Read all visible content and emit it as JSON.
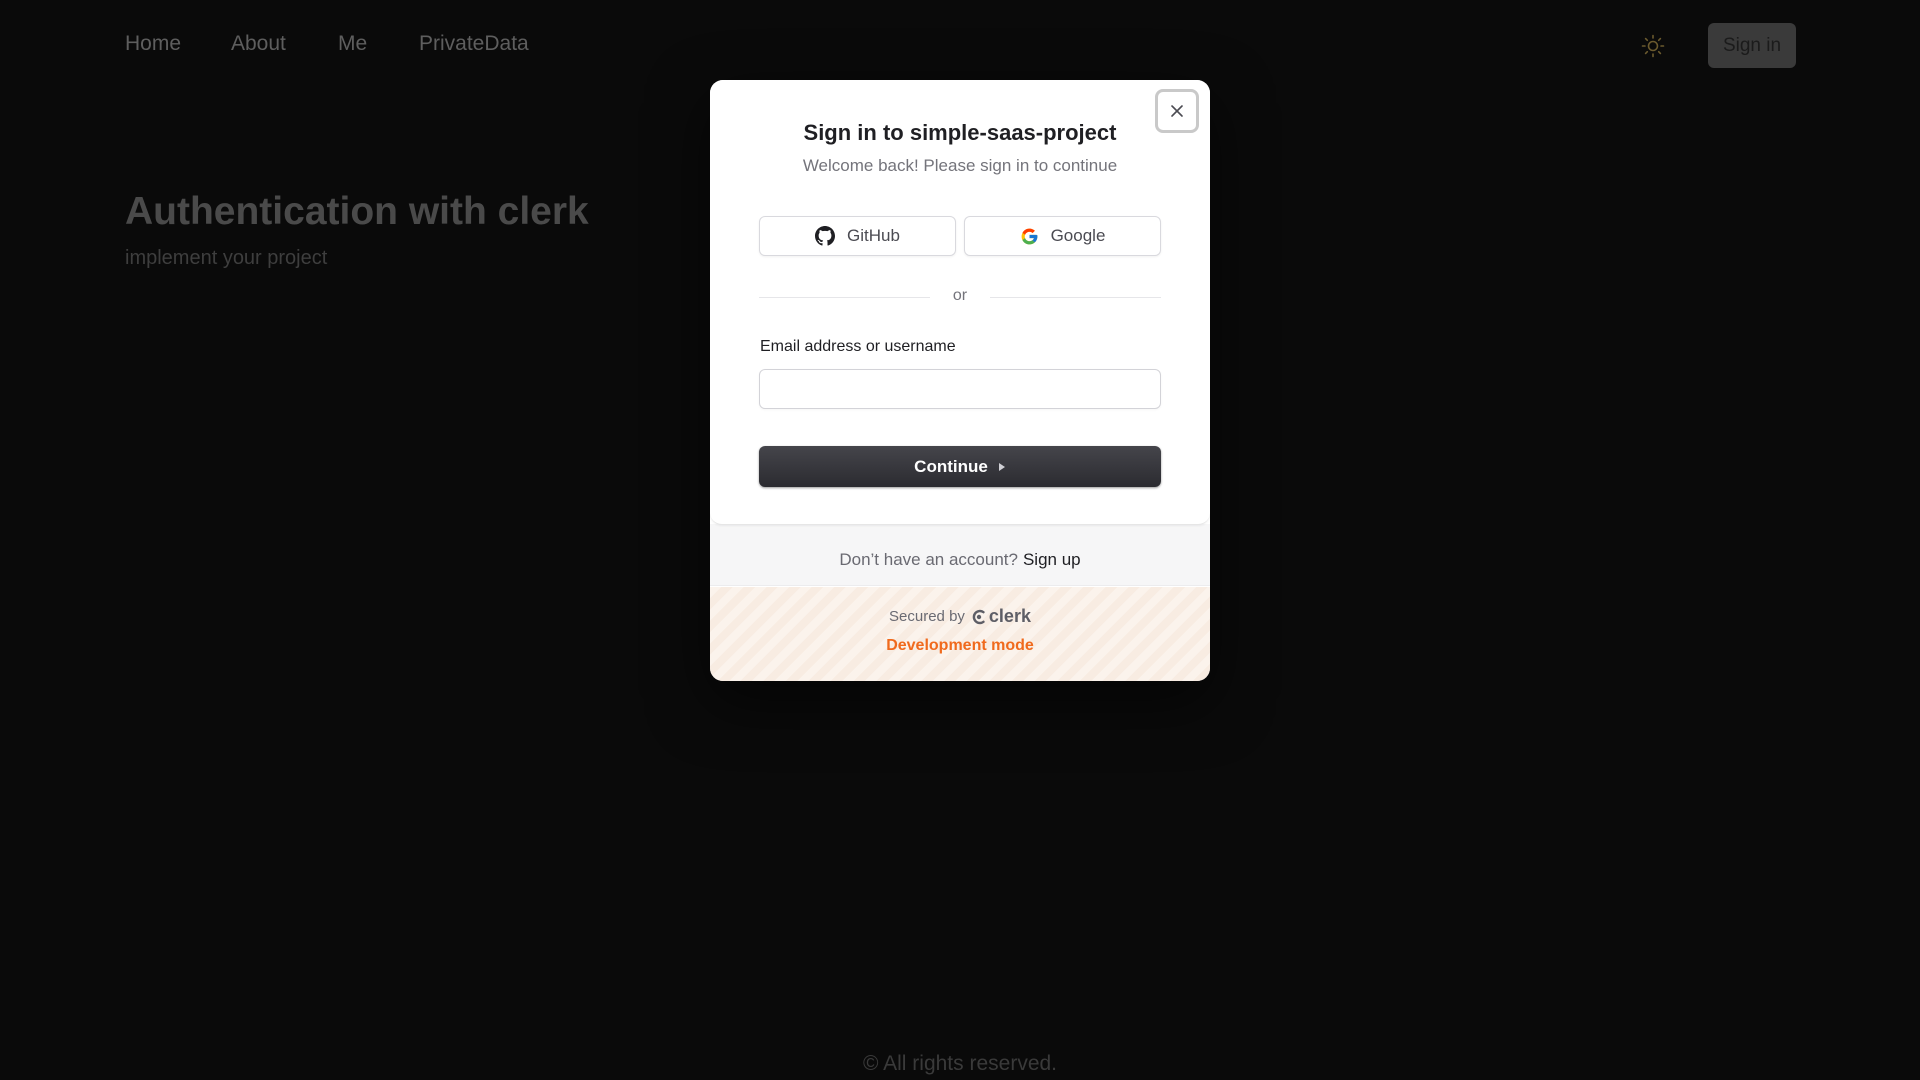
{
  "nav": {
    "links": [
      "Home",
      "About",
      "Me",
      "PrivateData"
    ],
    "signin_label": "Sign in",
    "theme_icon": "sun-icon"
  },
  "hero": {
    "title": "Authentication with clerk",
    "subtitle": "implement your project"
  },
  "footer": {
    "text": "© All rights reserved."
  },
  "modal": {
    "title": "Sign in to simple-saas-project",
    "subtitle": "Welcome back! Please sign in to continue",
    "social": {
      "github_label": "GitHub",
      "google_label": "Google"
    },
    "divider_text": "or",
    "email_label": "Email address or username",
    "email_value": "",
    "continue_label": "Continue",
    "signup_prompt": "Don’t have an account?",
    "signup_link": "Sign up",
    "secured_by": "Secured by",
    "brand": "clerk",
    "dev_mode": "Development mode"
  },
  "colors": {
    "accent_orange": "#f06a1d",
    "primary_button": "#2f2f34",
    "background": "#0a0a0a"
  }
}
